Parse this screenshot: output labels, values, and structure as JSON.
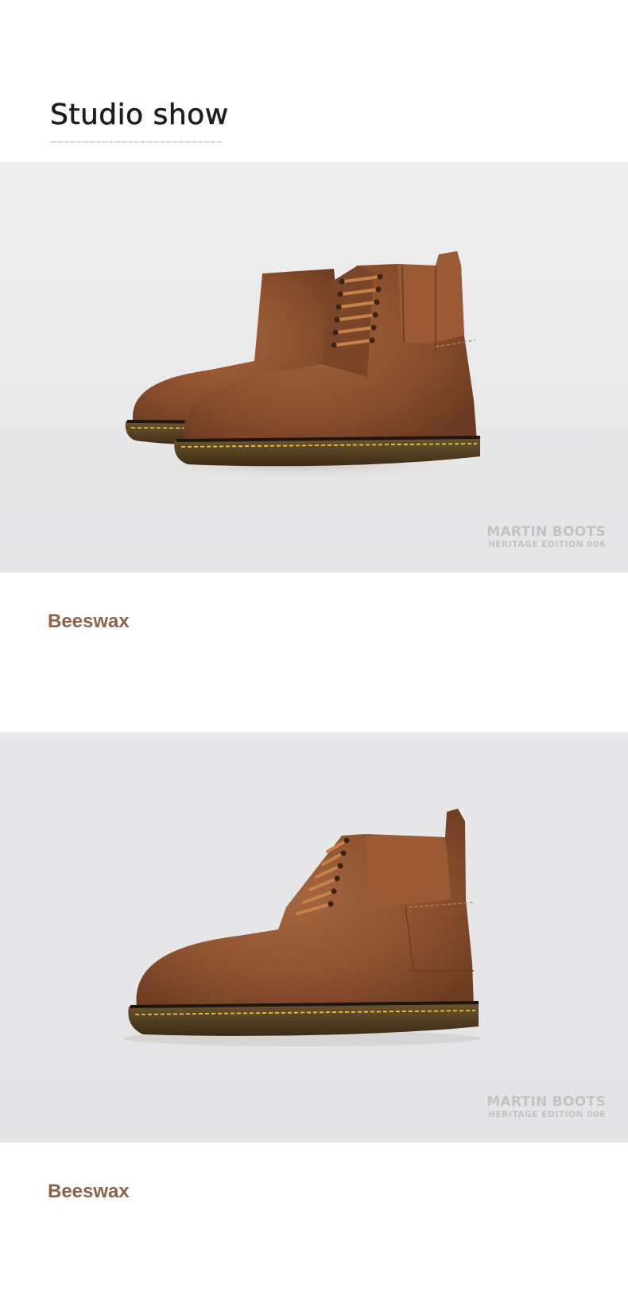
{
  "section": {
    "title": "Studio show"
  },
  "photos": [
    {
      "alt": "pair-of-boots",
      "watermark": {
        "line1": "MARTIN BOOTS",
        "line2": "HERITAGE EDITION 006"
      },
      "caption": "Beeswax"
    },
    {
      "alt": "single-boot-side",
      "watermark": {
        "line1": "MARTIN BOOTS",
        "line2": "HERITAGE EDITION 006"
      },
      "caption": "Beeswax"
    }
  ],
  "colors": {
    "caption": "#8e6247",
    "leather": "#8a4e2c",
    "sole": "#5b4326",
    "stitch": "#e6c24a",
    "background": "#e9e9ea"
  }
}
